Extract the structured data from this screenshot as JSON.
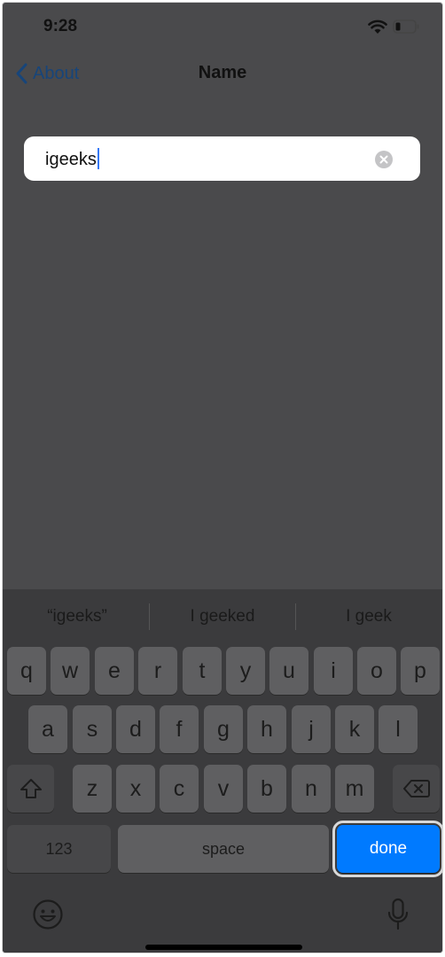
{
  "status": {
    "time": "9:28"
  },
  "nav": {
    "back_label": "About",
    "title": "Name"
  },
  "field": {
    "value": "igeeks"
  },
  "suggestions": [
    "“igeeks”",
    "I geeked",
    "I geek"
  ],
  "keyboard": {
    "row1": [
      "q",
      "w",
      "e",
      "r",
      "t",
      "y",
      "u",
      "i",
      "o",
      "p"
    ],
    "row2": [
      "a",
      "s",
      "d",
      "f",
      "g",
      "h",
      "j",
      "k",
      "l"
    ],
    "row3": [
      "z",
      "x",
      "c",
      "v",
      "b",
      "n",
      "m"
    ],
    "numbers_label": "123",
    "space_label": "space",
    "done_label": "done"
  },
  "colors": {
    "accent": "#007aff",
    "back_link": "#17457a",
    "caret": "#3478f6"
  }
}
